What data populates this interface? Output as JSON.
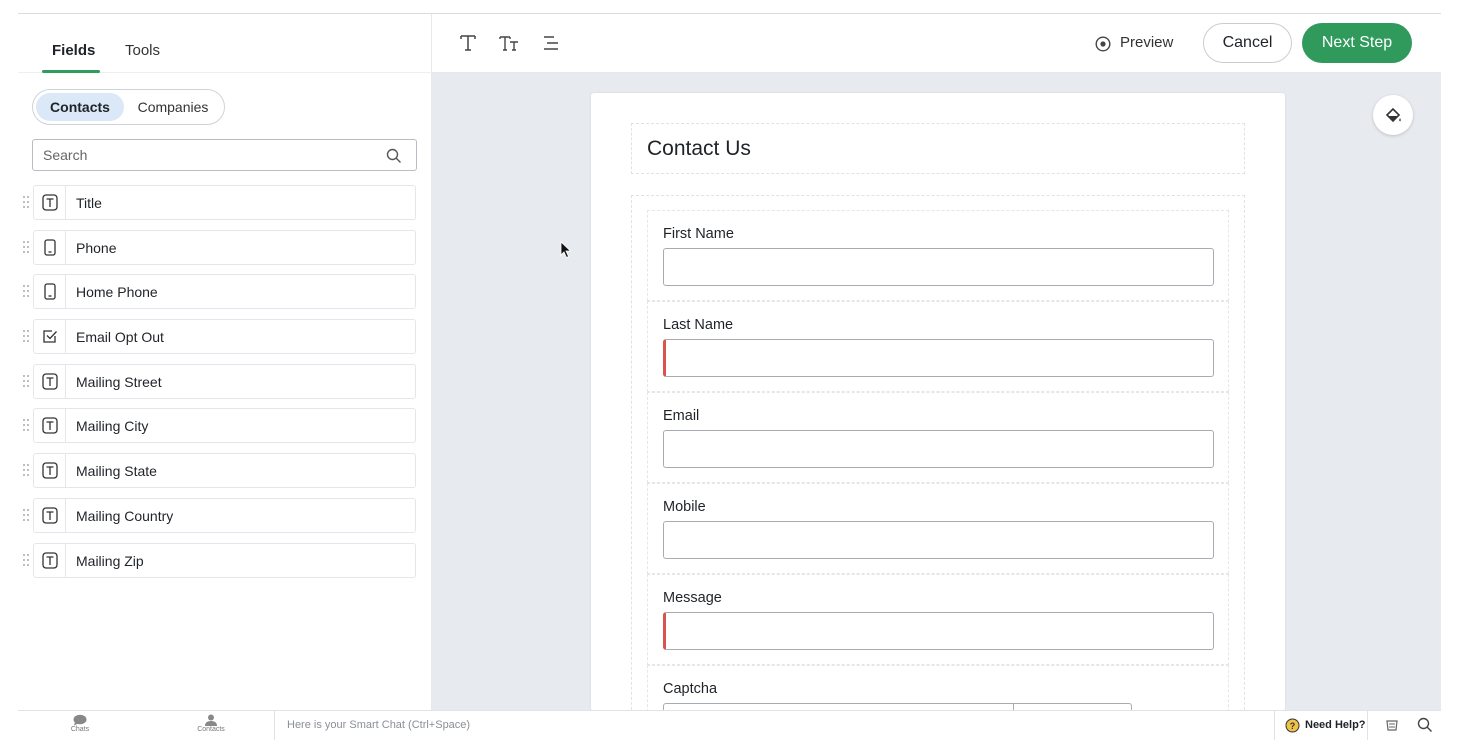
{
  "left_panel": {
    "tabs": [
      {
        "label": "Fields",
        "active": true
      },
      {
        "label": "Tools",
        "active": false
      }
    ],
    "segment": {
      "options": [
        "Contacts",
        "Companies"
      ],
      "selected": "Contacts"
    },
    "search": {
      "placeholder": "Search",
      "icon": "search-icon"
    },
    "fields": [
      {
        "label": "Title",
        "icon": "text-field-icon"
      },
      {
        "label": "Phone",
        "icon": "phone-icon"
      },
      {
        "label": "Home Phone",
        "icon": "phone-icon"
      },
      {
        "label": "Email Opt Out",
        "icon": "checkbox-icon"
      },
      {
        "label": "Mailing Street",
        "icon": "text-field-icon"
      },
      {
        "label": "Mailing City",
        "icon": "text-field-icon"
      },
      {
        "label": "Mailing State",
        "icon": "text-field-icon"
      },
      {
        "label": "Mailing Country",
        "icon": "text-field-icon"
      },
      {
        "label": "Mailing Zip",
        "icon": "text-field-icon"
      }
    ]
  },
  "toolbar": {
    "icons": [
      "text-icon",
      "text-size-icon",
      "align-icon"
    ],
    "preview_label": "Preview",
    "cancel_label": "Cancel",
    "next_label": "Next Step",
    "accent_color": "#2f9a5c"
  },
  "form": {
    "title": "Contact Us",
    "fields": [
      {
        "label": "First Name",
        "required": false
      },
      {
        "label": "Last Name",
        "required": true
      },
      {
        "label": "Email",
        "required": false
      },
      {
        "label": "Mobile",
        "required": false
      },
      {
        "label": "Message",
        "required": true
      },
      {
        "label": "Captcha",
        "required": false
      }
    ]
  },
  "bottom_bar": {
    "chats_label": "Chats",
    "contacts_label": "Contacts",
    "smart_chat_placeholder": "Here is your Smart Chat (Ctrl+Space)",
    "need_help_label": "Need Help?"
  }
}
